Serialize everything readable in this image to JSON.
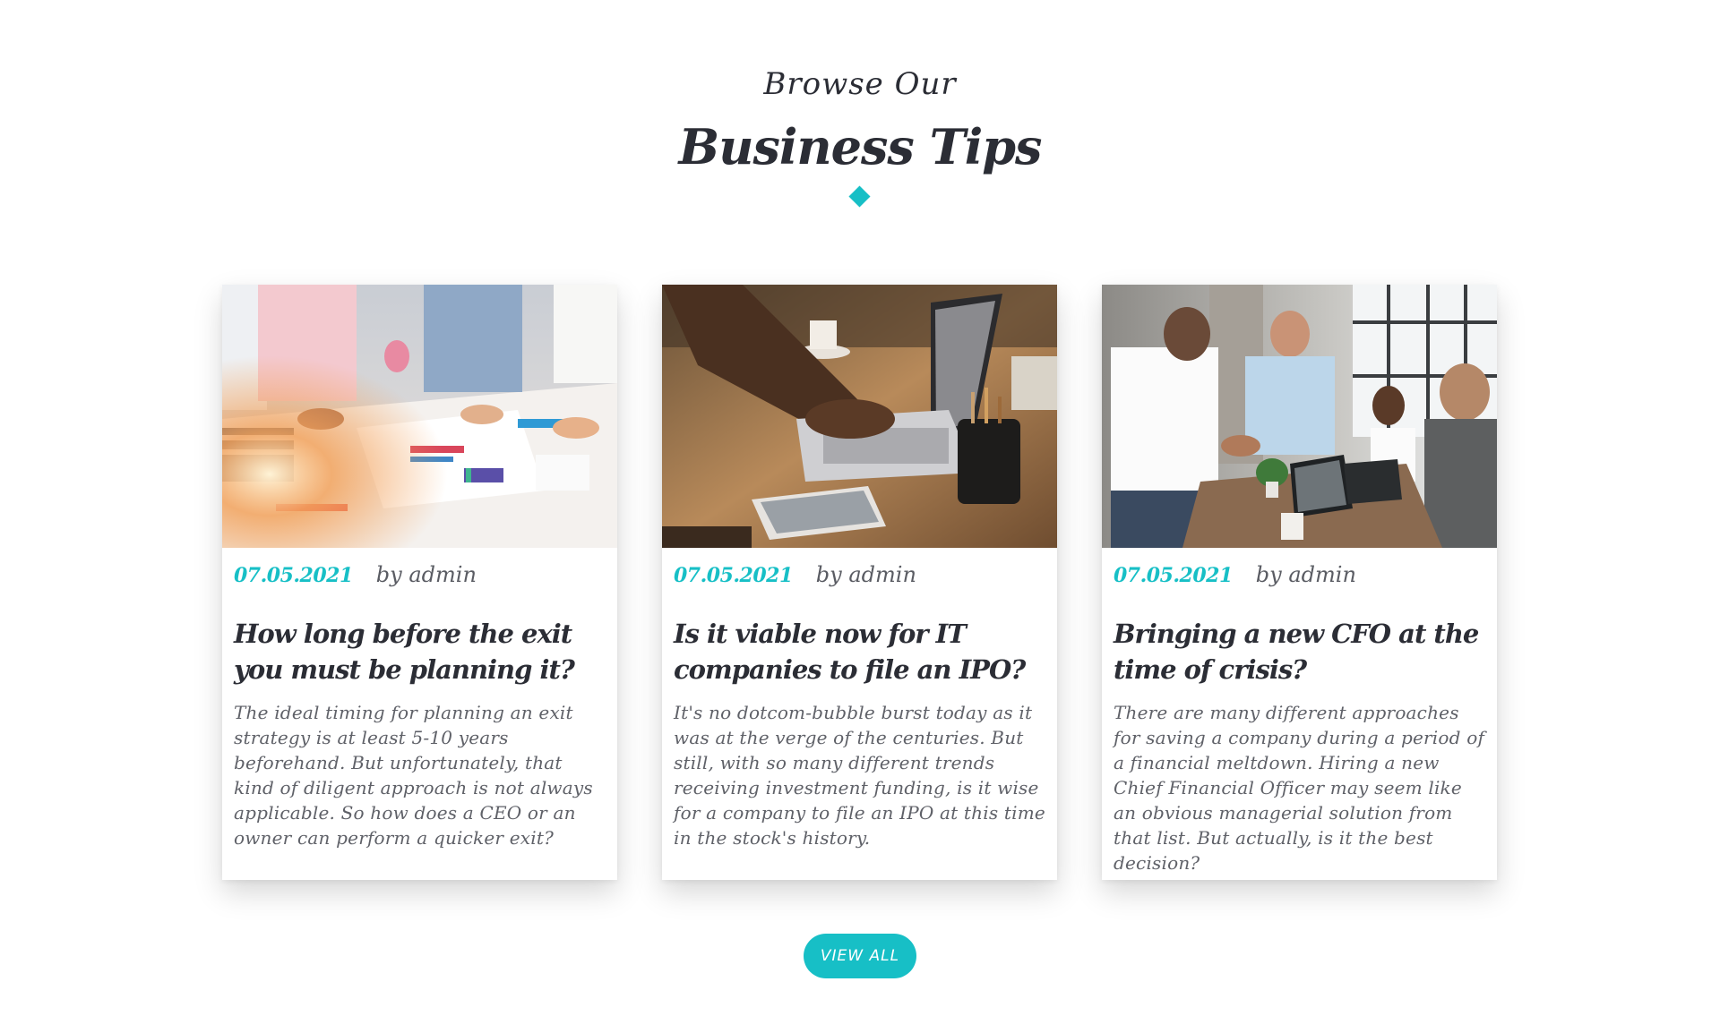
{
  "colors": {
    "accent": "#17bfc6",
    "heading": "#2b2d35",
    "text": "#5f6168"
  },
  "header": {
    "subtitle": "Browse Our",
    "title": "Business Tips"
  },
  "posts": [
    {
      "date": "07.05.2021",
      "author": "by admin",
      "title": "How long before the exit you must be planning it?",
      "excerpt": "The ideal timing for planning an exit strategy is at least 5-10 years beforehand. But unfortunately, that kind of diligent approach is not always applicable. So how does a CEO or an owner can perform a quicker exit?",
      "image_icon": "team-planning-charts-photo"
    },
    {
      "date": "07.05.2021",
      "author": "by admin",
      "title": "Is it viable now for IT companies to file an IPO?",
      "excerpt": "It's no dotcom-bubble burst today as it was at the verge of the centuries. But still, with so many different trends receiving investment funding, is it wise for a company to file an IPO at this time in the stock's history.",
      "image_icon": "laptop-typing-photo"
    },
    {
      "date": "07.05.2021",
      "author": "by admin",
      "title": "Bringing a new CFO at the time of crisis?",
      "excerpt": "There are many different approaches for saving a company during a period of a financial meltdown. Hiring a new Chief Financial Officer may seem like an obvious managerial solution from that list. But actually, is it the best decision?",
      "image_icon": "office-handshake-photo"
    }
  ],
  "cta": {
    "label": "VIEW ALL"
  }
}
